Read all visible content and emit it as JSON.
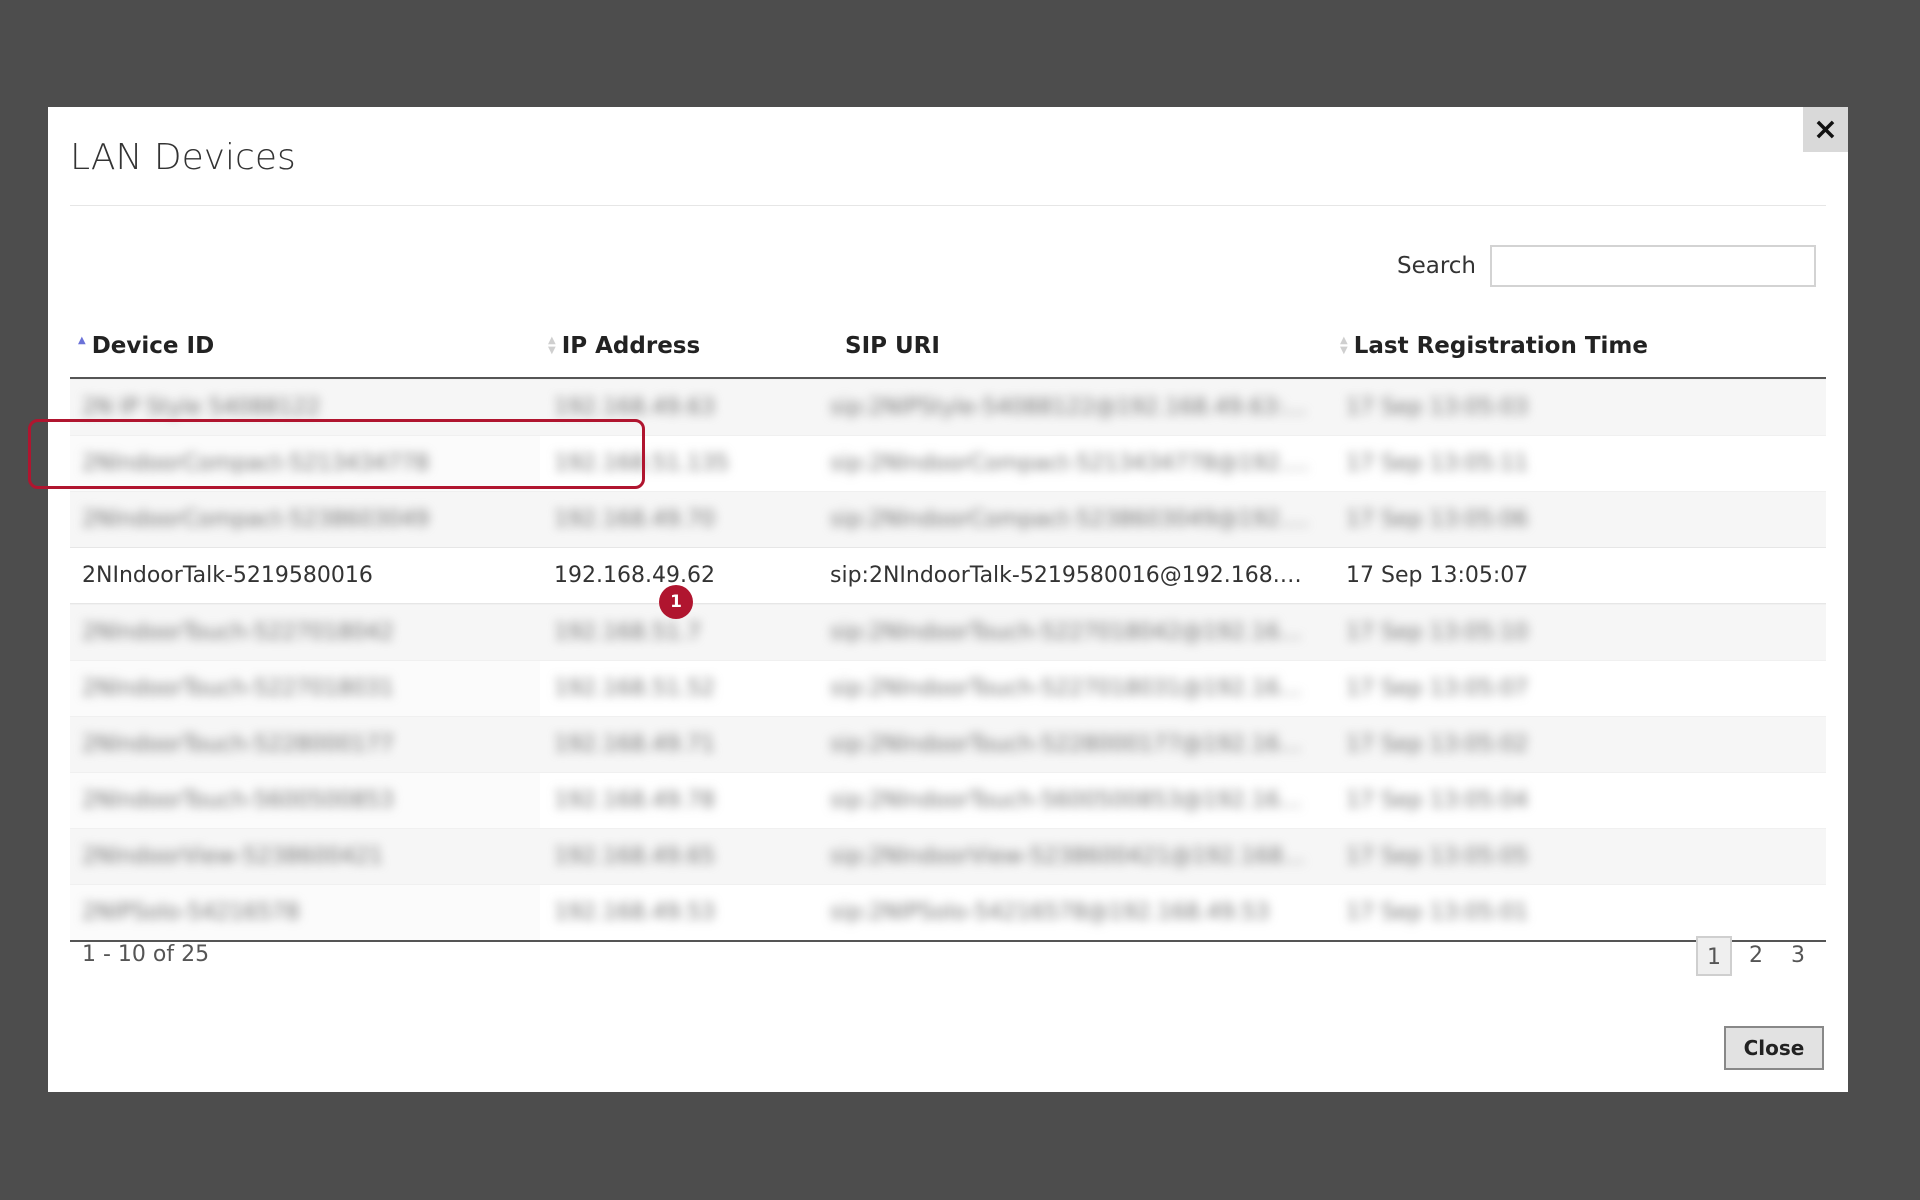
{
  "dialog": {
    "title": "LAN Devices",
    "close_icon": "×",
    "close_button_label": "Close"
  },
  "search": {
    "label": "Search",
    "value": "",
    "placeholder": ""
  },
  "table": {
    "columns": [
      {
        "label": "Device ID",
        "sort": "ascending"
      },
      {
        "label": "IP Address",
        "sort": "none"
      },
      {
        "label": "SIP URI",
        "sort": "disabled"
      },
      {
        "label": "Last Registration Time",
        "sort": "none"
      }
    ],
    "rows": [
      {
        "device_id": "2N IP Style 54088122",
        "ip": "192.168.49.63",
        "sip": "sip:2NIPStyle-54088122@192.168.49.63:5070",
        "time": "17 Sep 13:05:03",
        "blurred": true
      },
      {
        "device_id": "2NIndoorCompact-5213434778",
        "ip": "192.168.51.135",
        "sip": "sip:2NIndoorCompact-5213434778@192.168.51.135",
        "time": "17 Sep 13:05:11",
        "blurred": true
      },
      {
        "device_id": "2NIndoorCompact-5238603049",
        "ip": "192.168.49.70",
        "sip": "sip:2NIndoorCompact-5238603049@192.168.49.70",
        "time": "17 Sep 13:05:06",
        "blurred": true
      },
      {
        "device_id": "2NIndoorTalk-5219580016",
        "ip": "192.168.49.62",
        "sip": "sip:2NIndoorTalk-5219580016@192.168.49.62...",
        "time": "17 Sep 13:05:07",
        "blurred": false
      },
      {
        "device_id": "2NIndoorTouch-5227018042",
        "ip": "192.168.51.7",
        "sip": "sip:2NIndoorTouch-5227018042@192.168.51.7",
        "time": "17 Sep 13:05:10",
        "blurred": true
      },
      {
        "device_id": "2NIndoorTouch-5227018031",
        "ip": "192.168.51.52",
        "sip": "sip:2NIndoorTouch-5227018031@192.168.51.52",
        "time": "17 Sep 13:05:07",
        "blurred": true
      },
      {
        "device_id": "2NIndoorTouch-5228000177",
        "ip": "192.168.49.71",
        "sip": "sip:2NIndoorTouch-5228000177@192.168.49.71",
        "time": "17 Sep 13:05:02",
        "blurred": true
      },
      {
        "device_id": "2NIndoorTouch-5600500853",
        "ip": "192.168.49.78",
        "sip": "sip:2NIndoorTouch-5600500853@192.168.49.78",
        "time": "17 Sep 13:05:04",
        "blurred": true
      },
      {
        "device_id": "2NIndoorView-5238600421",
        "ip": "192.168.49.65",
        "sip": "sip:2NIndoorView-5238600421@192.168.49.65",
        "time": "17 Sep 13:05:05",
        "blurred": true
      },
      {
        "device_id": "2NIPSolo-54216578",
        "ip": "192.168.49.53",
        "sip": "sip:2NIPSolo-54216578@192.168.49.53",
        "time": "17 Sep 13:05:01",
        "blurred": true
      }
    ]
  },
  "annotation": {
    "badge": "1"
  },
  "footer": {
    "range_text": "1 - 10 of 25",
    "pages": [
      "1",
      "2",
      "3"
    ],
    "active_page": "1"
  }
}
